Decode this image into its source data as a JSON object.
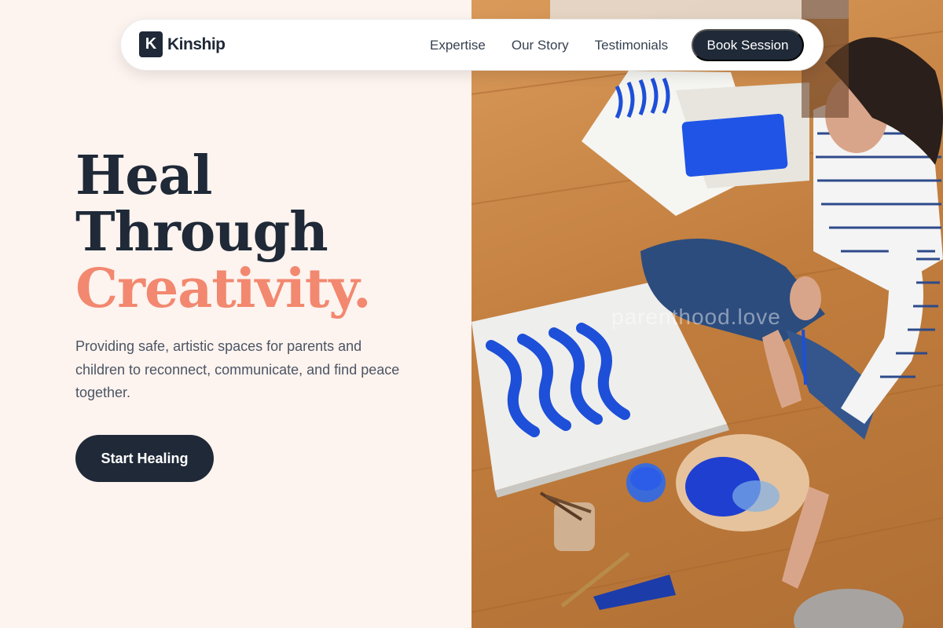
{
  "nav": {
    "brand_mark": "K",
    "brand_name": "Kinship",
    "links": [
      {
        "label": "Expertise"
      },
      {
        "label": "Our Story"
      },
      {
        "label": "Testimonials"
      }
    ],
    "cta_label": "Book Session"
  },
  "hero": {
    "headline_line1": "Heal",
    "headline_line2": "Through",
    "headline_line3": "Creativity.",
    "subtext": "Providing safe, artistic spaces for parents and children to reconnect, communicate, and find peace together.",
    "cta_label": "Start Healing"
  },
  "photo": {
    "watermark": "parenthood.love"
  },
  "colors": {
    "navy": "#1f2937",
    "accent": "#f2886f",
    "background": "#fdf3ef",
    "paint_blue": "#1d4fd8"
  }
}
